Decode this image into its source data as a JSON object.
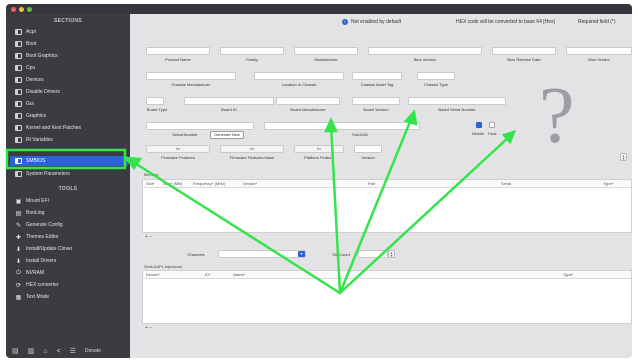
{
  "sidebar": {
    "sections_heading": "SECTIONS",
    "sections": [
      {
        "label": "Acpi",
        "icon": "list-icon"
      },
      {
        "label": "Boot",
        "icon": "list-icon"
      },
      {
        "label": "Boot Graphics",
        "icon": "list-icon"
      },
      {
        "label": "Cpu",
        "icon": "list-icon"
      },
      {
        "label": "Devices",
        "icon": "list-icon"
      },
      {
        "label": "Disable Drivers",
        "icon": "list-icon"
      },
      {
        "label": "Gui",
        "icon": "list-icon"
      },
      {
        "label": "Graphics",
        "icon": "list-icon"
      },
      {
        "label": "Kernel and Kext Patches",
        "icon": "list-icon"
      },
      {
        "label": "Rt Variables",
        "icon": "list-icon"
      },
      {
        "label": "SMBIOS",
        "icon": "list-icon"
      },
      {
        "label": "System Parameters",
        "icon": "list-icon"
      }
    ],
    "selected": "SMBIOS",
    "tools_heading": "TOOLS",
    "tools": [
      {
        "label": "Mount EFI",
        "glyph": "▣"
      },
      {
        "label": "Boot.log",
        "glyph": "▤"
      },
      {
        "label": "Generate Config",
        "glyph": "✎"
      },
      {
        "label": "Themes Editor",
        "glyph": "✚"
      },
      {
        "label": "Install/Update Clover",
        "glyph": "⬇"
      },
      {
        "label": "Install Drivers",
        "glyph": "⬇"
      },
      {
        "label": "NVRAM",
        "glyph": "⏻"
      },
      {
        "label": "HEX converter",
        "glyph": "⟳"
      },
      {
        "label": "Text Mode",
        "glyph": "▦"
      }
    ],
    "bottom_label": "Donate"
  },
  "header": {
    "not_enabled": "Not enabled by default",
    "hex_note": "HEX code will be converted to base 64 [Hex]",
    "required": "Required field (*)"
  },
  "smbios": {
    "row1_labels": [
      "Product Name",
      "Family",
      "Manufacturer",
      "Bios Version",
      "Bios Release Date",
      "Bios Vendor"
    ],
    "row2_labels": [
      "Chassis Manufacturer",
      "Location in Chassis",
      "Chassis Asset Tag",
      "Chassis Type"
    ],
    "row3_labels": [
      "Board Type",
      "Board ID",
      "Board Manufacturer",
      "Board Version",
      "Board Serial Number"
    ],
    "row4_labels": [
      "Serial Number",
      "Generate New",
      "SmUUID",
      "Mobile",
      "Trust"
    ],
    "row5_pill": "0x",
    "row5_labels": [
      "Firmware Features",
      "Firmware Features Mask",
      "Platform Feature",
      "Version"
    ]
  },
  "memory": {
    "heading": "Memory",
    "columns": [
      "Slot*",
      "Size* (MB)",
      "Frequency* (MHz)",
      "Vendor*",
      "Part",
      "Serial",
      "Type*"
    ],
    "channels_label": "Channels",
    "slotcount_label": "SlotCount"
  },
  "slots": {
    "heading": "Slots AAPL Injections",
    "columns": [
      "Device*",
      "ID*",
      "Name*",
      "Type*"
    ]
  }
}
